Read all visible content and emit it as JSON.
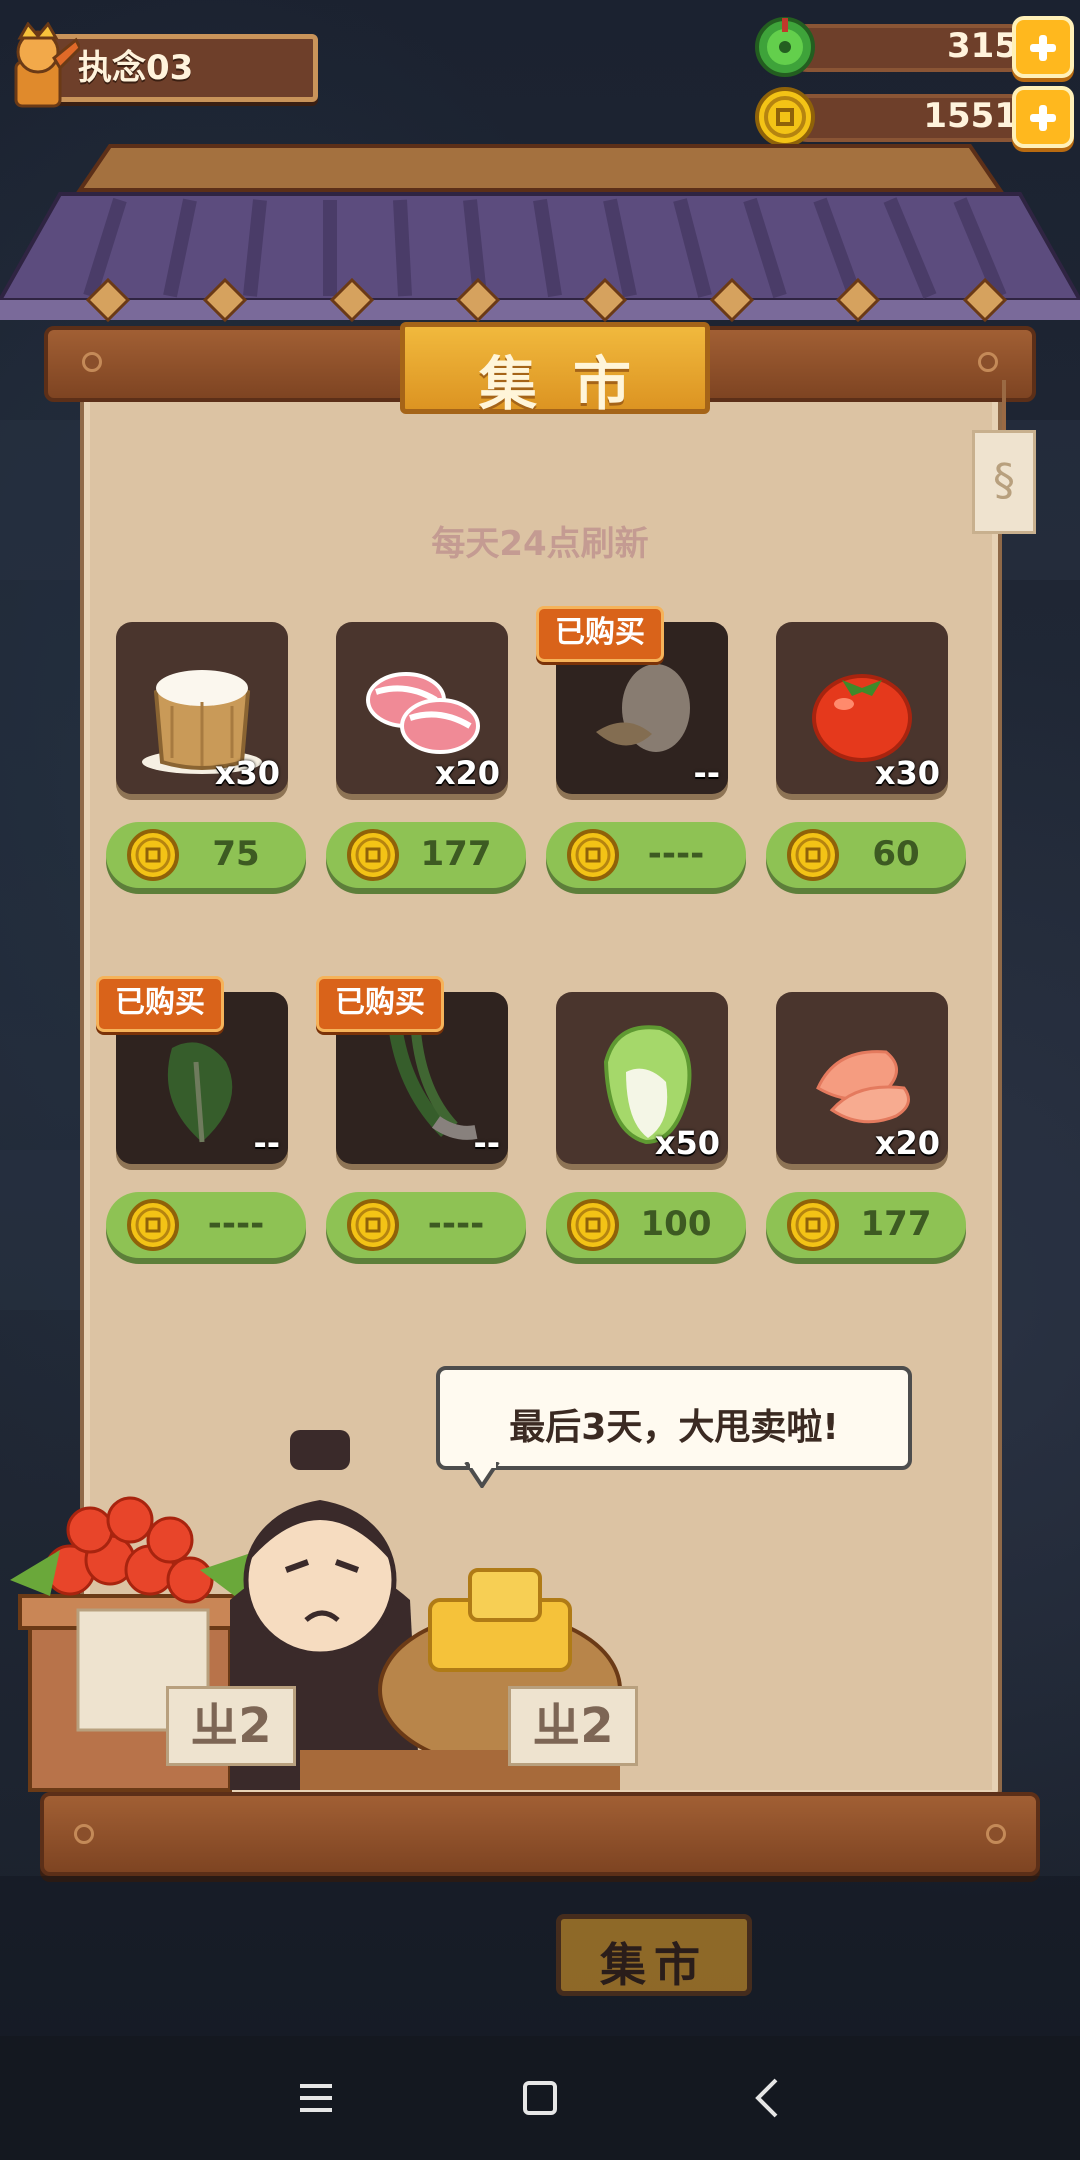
{
  "player": {
    "name": "执念03"
  },
  "resources": {
    "jade": {
      "value": "315",
      "icon": "jade-coin-icon"
    },
    "coins": {
      "value": "1551",
      "icon": "copper-coin-icon"
    }
  },
  "market": {
    "title": "集市",
    "refresh_note": "每天24点刷新",
    "purchased_label": "已购买",
    "items": [
      {
        "name": "rice-sack",
        "qty": "x30",
        "price": "75",
        "bought": false
      },
      {
        "name": "pork-belly",
        "qty": "x20",
        "price": "177",
        "bought": false
      },
      {
        "name": "egg",
        "qty": "--",
        "price": "----",
        "bought": true
      },
      {
        "name": "tomato",
        "qty": "x30",
        "price": "60",
        "bought": false
      },
      {
        "name": "spinach",
        "qty": "--",
        "price": "----",
        "bought": true
      },
      {
        "name": "scallion",
        "qty": "--",
        "price": "----",
        "bought": true
      },
      {
        "name": "napa-cabbage",
        "qty": "x50",
        "price": "100",
        "bought": false
      },
      {
        "name": "chicken-breast",
        "qty": "x20",
        "price": "177",
        "bought": false
      }
    ],
    "speech": "最后3天，大甩卖啦!",
    "stall_signs": [
      "ㄓ2",
      "ㄓ2"
    ]
  },
  "background": {
    "sign": "集市"
  },
  "colors": {
    "price_button": "#8ec254",
    "badge": "#d9631a",
    "panel": "#dcc3a3",
    "roof": "#5a4a78"
  }
}
